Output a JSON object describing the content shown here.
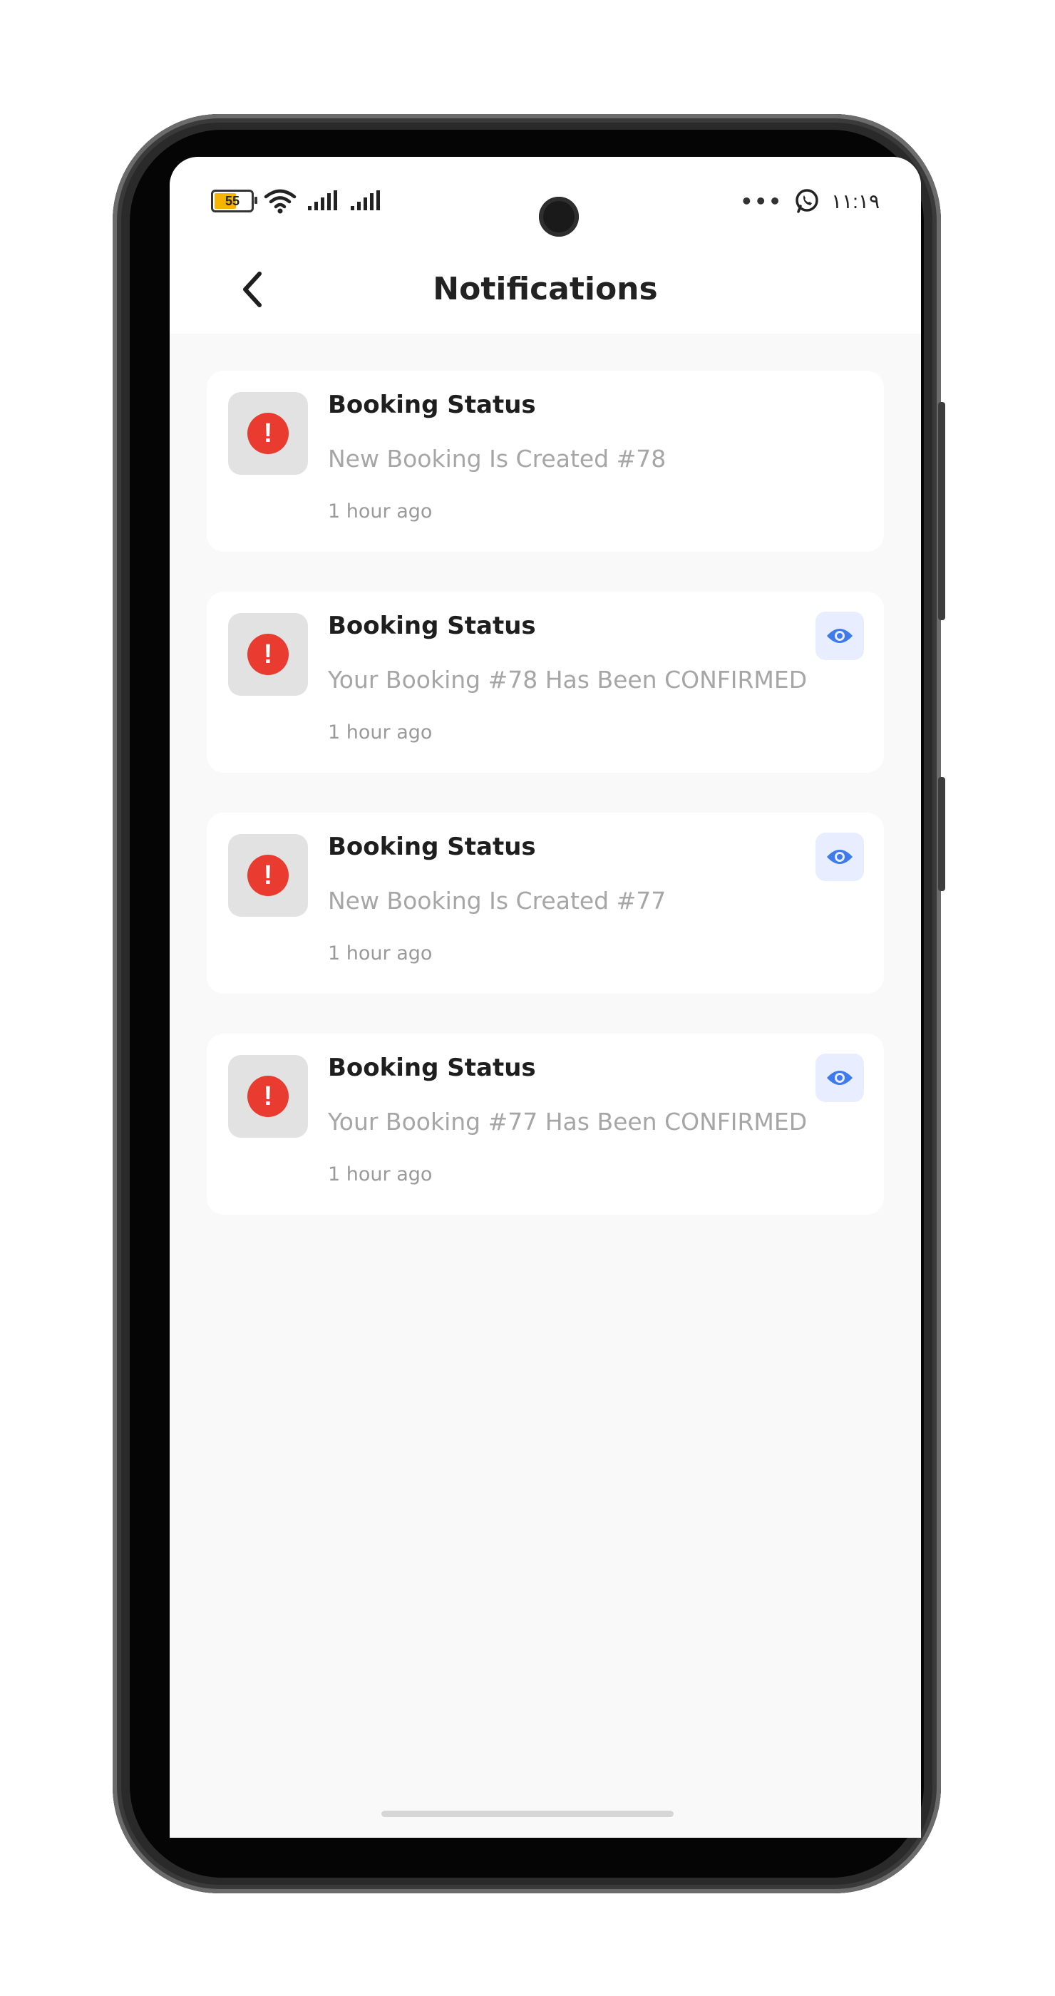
{
  "status_bar": {
    "battery_level": "55",
    "time": "١١:١٩",
    "more_icon": "more-dots-icon",
    "whatsapp_icon": "whatsapp-icon",
    "wifi_icon": "wifi-icon",
    "signal_icon": "signal-bars-icon"
  },
  "header": {
    "title": "Notifications",
    "back_icon": "chevron-left-icon"
  },
  "colors": {
    "alert_red": "#e93b30",
    "eye_blue": "#3f7bea",
    "eye_bg": "#e8edff"
  },
  "notifications": [
    {
      "title": "Booking Status",
      "message": "New Booking Is Created #78",
      "time": "1 hour ago",
      "has_view_button": false
    },
    {
      "title": "Booking Status",
      "message": "Your Booking #78 Has Been CONFIRMED",
      "time": "1 hour ago",
      "has_view_button": true
    },
    {
      "title": "Booking Status",
      "message": "New Booking Is Created #77",
      "time": "1 hour ago",
      "has_view_button": true
    },
    {
      "title": "Booking Status",
      "message": "Your Booking #77 Has Been CONFIRMED",
      "time": "1 hour ago",
      "has_view_button": true
    }
  ]
}
